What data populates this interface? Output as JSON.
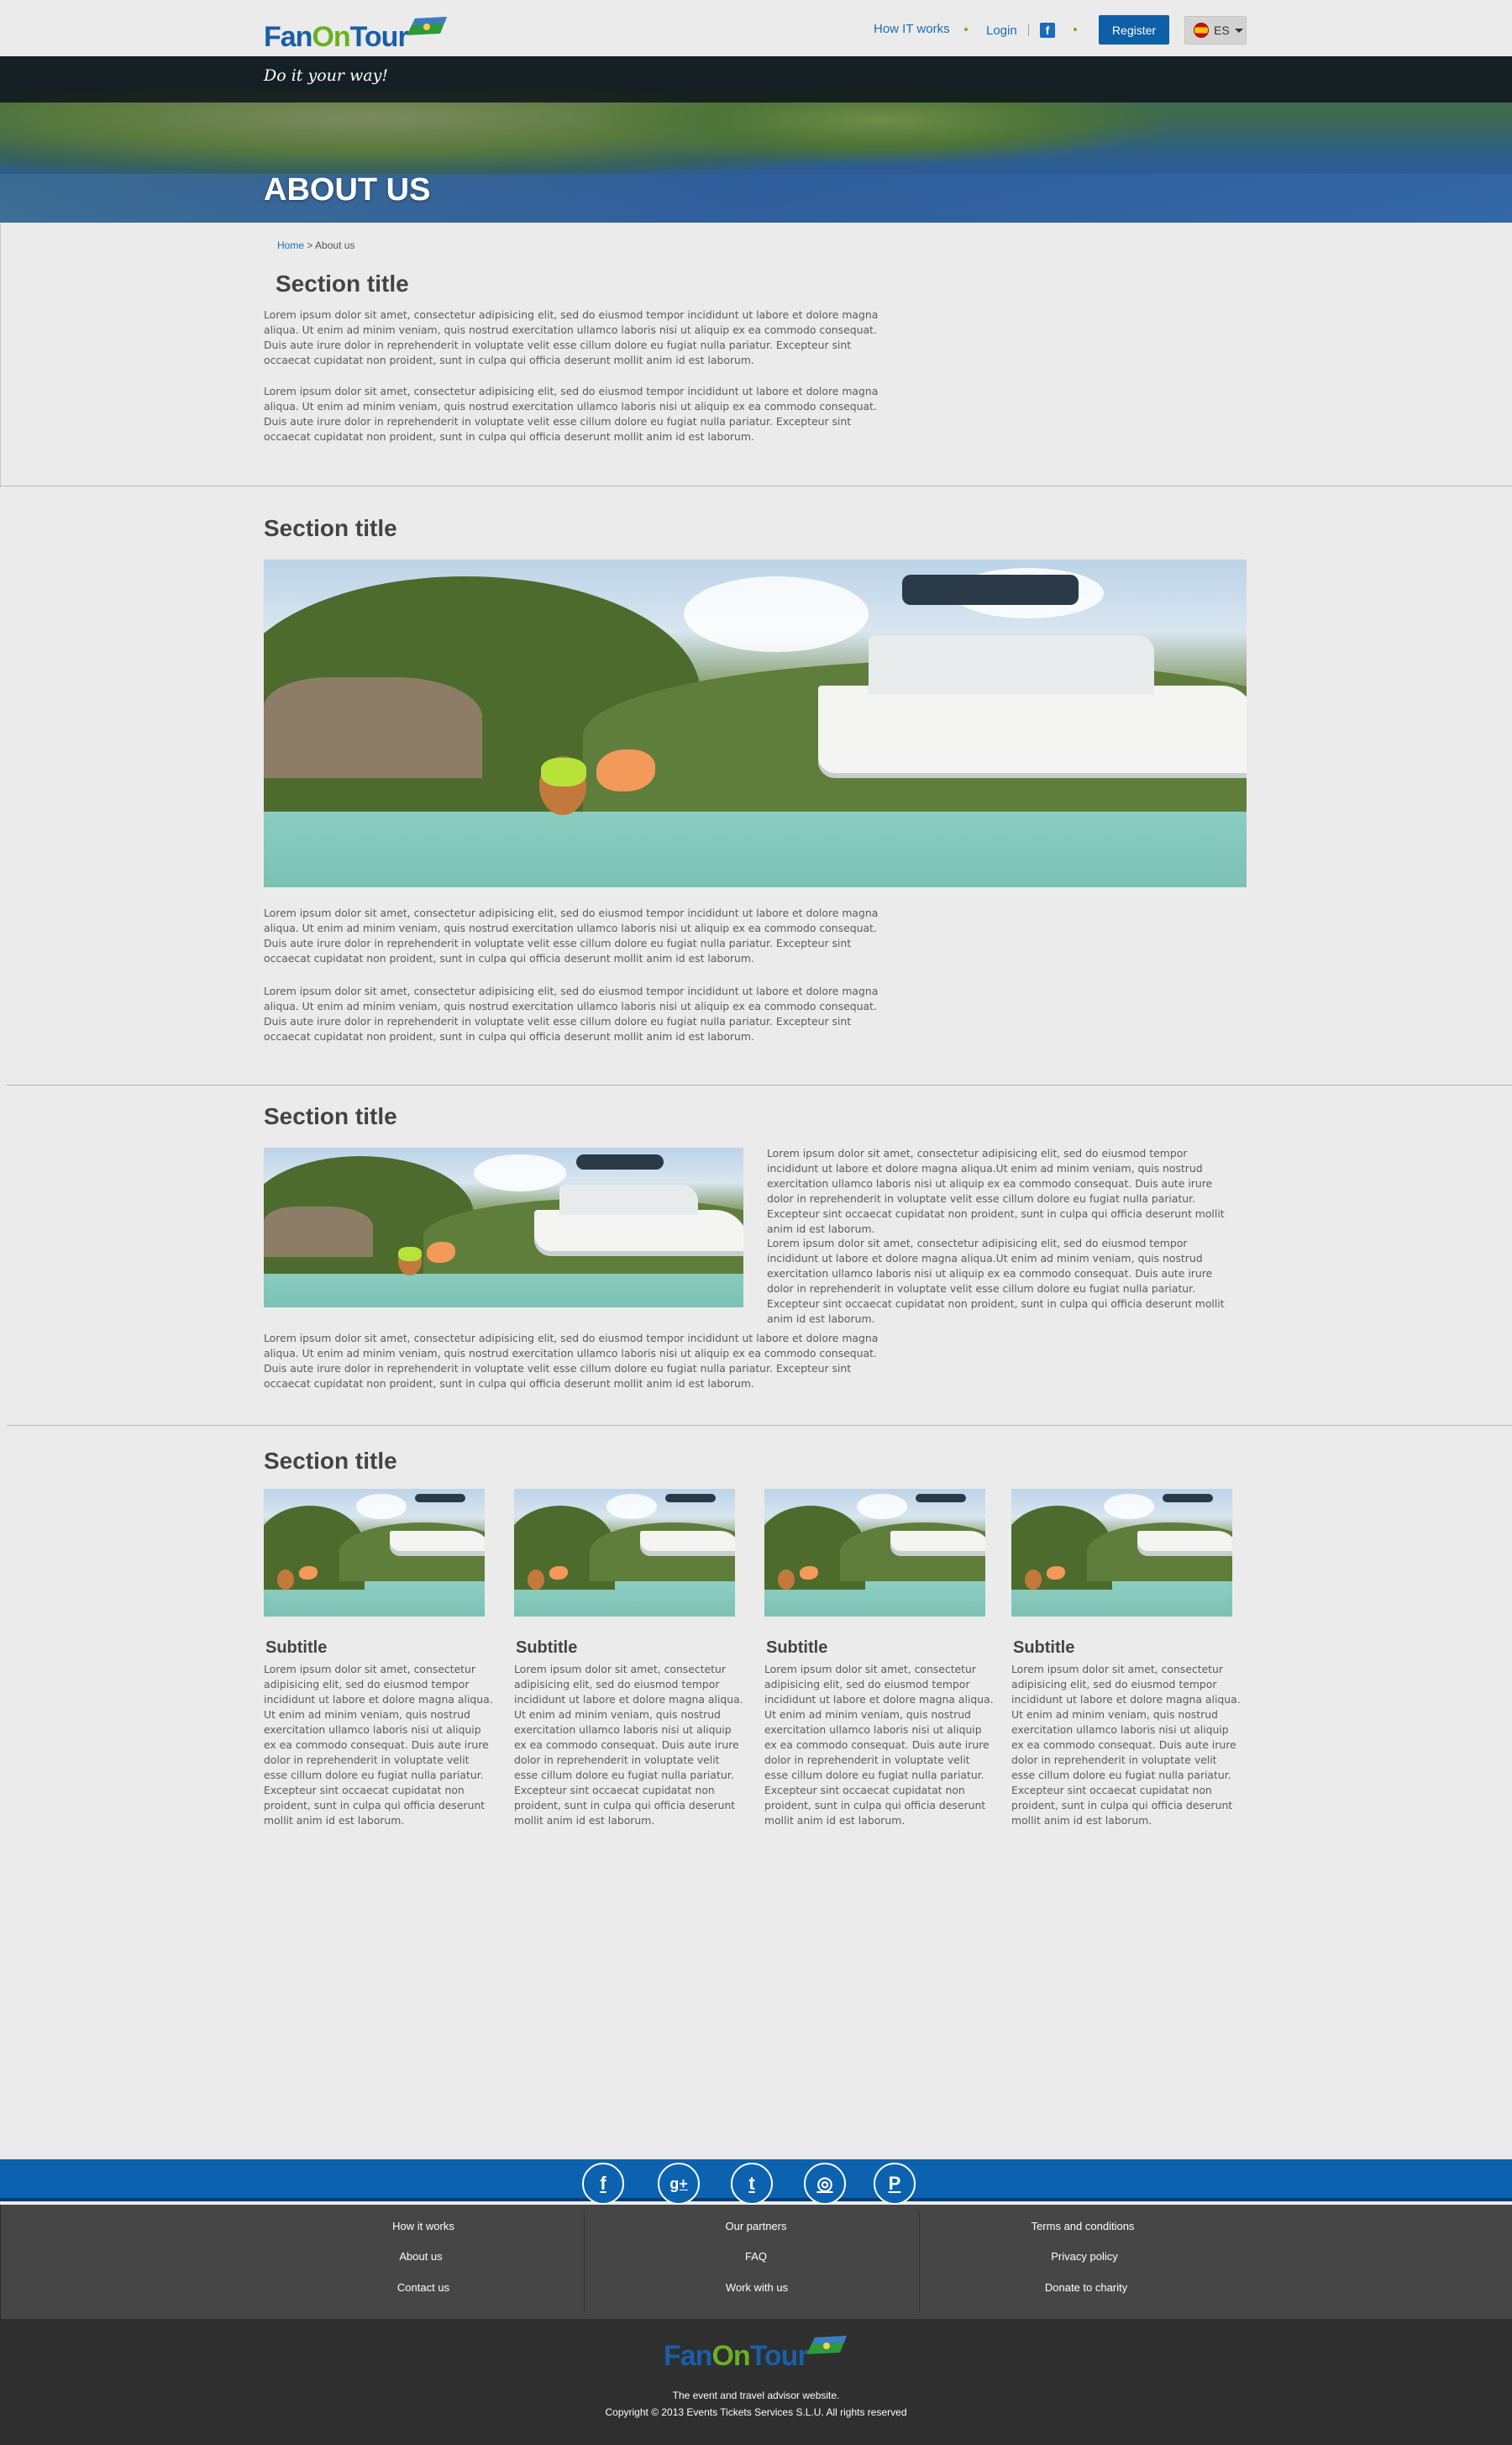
{
  "brand": {
    "fan": "Fan",
    "on": "On",
    "tour": "Tour",
    "tagline": "Do it your way!"
  },
  "header": {
    "nav": {
      "how_it_works": "How IT works",
      "login": "Login",
      "facebook": "f"
    },
    "register": "Register",
    "language": "ES"
  },
  "hero": {
    "title": "ABOUT US"
  },
  "breadcrumb": {
    "home": "Home",
    "separator": ">",
    "current": "About us"
  },
  "sections": [
    {
      "title": "Section title",
      "paragraphs": [
        "Lorem ipsum dolor sit amet, consectetur adipisicing elit, sed do eiusmod tempor incididunt ut labore et dolore magna aliqua. Ut enim ad minim veniam, quis nostrud exercitation ullamco laboris nisi ut aliquip ex ea commodo consequat. Duis aute irure dolor in reprehenderit in voluptate velit esse cillum dolore eu fugiat nulla pariatur. Excepteur sint occaecat cupidatat non proident, sunt in culpa qui officia deserunt mollit anim id est laborum.",
        "Lorem ipsum dolor sit amet, consectetur adipisicing elit, sed do eiusmod tempor incididunt ut labore et dolore magna aliqua. Ut enim ad minim veniam, quis nostrud exercitation ullamco laboris nisi ut aliquip ex ea commodo consequat. Duis aute irure dolor in reprehenderit in voluptate velit esse cillum dolore eu fugiat nulla pariatur. Excepteur sint occaecat cupidatat non proident, sunt in culpa qui officia deserunt mollit anim id est laborum."
      ]
    },
    {
      "title": "Section title",
      "paragraphs": [
        "Lorem ipsum dolor sit amet, consectetur adipisicing elit, sed do eiusmod tempor incididunt ut labore et dolore magna aliqua. Ut enim ad minim veniam, quis nostrud exercitation ullamco laboris nisi ut aliquip ex ea commodo consequat. Duis aute irure dolor in reprehenderit in voluptate velit esse cillum dolore eu fugiat nulla pariatur. Excepteur sint occaecat cupidatat non proident, sunt in culpa qui officia deserunt mollit anim id est laborum.",
        "Lorem ipsum dolor sit amet, consectetur adipisicing elit, sed do eiusmod tempor incididunt ut labore et dolore magna aliqua. Ut enim ad minim veniam, quis nostrud exercitation ullamco laboris nisi ut aliquip ex ea commodo consequat. Duis aute irure dolor in reprehenderit in voluptate velit esse cillum dolore eu fugiat nulla pariatur. Excepteur sint occaecat cupidatat non proident, sunt in culpa qui officia deserunt mollit anim id est laborum."
      ]
    },
    {
      "title": "Section title",
      "side_paragraphs": [
        "Lorem ipsum dolor sit amet, consectetur adipisicing elit, sed do eiusmod tempor incididunt ut labore et dolore magna aliqua.Ut enim ad minim veniam, quis nostrud exercitation ullamco laboris nisi ut aliquip ex ea commodo consequat. Duis aute irure dolor in reprehenderit in voluptate velit esse cillum dolore eu fugiat nulla pariatur. Excepteur sint occaecat cupidatat non proident, sunt in culpa qui officia deserunt mollit anim id est laborum.",
        "Lorem ipsum dolor sit amet, consectetur adipisicing elit, sed do eiusmod tempor incididunt ut labore et dolore magna aliqua.Ut enim ad minim veniam, quis nostrud exercitation ullamco laboris nisi ut aliquip ex ea commodo consequat. Duis aute irure dolor in reprehenderit in voluptate velit esse cillum dolore eu fugiat nulla pariatur. Excepteur sint occaecat cupidatat non proident, sunt in culpa qui officia deserunt mollit anim id est laborum."
      ],
      "paragraph": "Lorem ipsum dolor sit amet, consectetur adipisicing elit, sed do eiusmod tempor incididunt ut labore et dolore magna aliqua. Ut enim ad minim veniam, quis nostrud exercitation ullamco laboris nisi ut aliquip ex ea commodo consequat. Duis aute irure dolor in reprehenderit in voluptate velit esse cillum dolore eu fugiat nulla pariatur. Excepteur sint occaecat cupidatat non proident, sunt in culpa qui officia deserunt mollit anim id est laborum."
    },
    {
      "title": "Section title",
      "cards": [
        {
          "subtitle": "Subtitle",
          "text": "Lorem ipsum dolor sit amet, consectetur adipisicing elit, sed do eiusmod tempor incididunt ut labore et dolore magna aliqua. Ut enim ad minim veniam, quis nostrud exercitation ullamco laboris nisi ut aliquip ex ea commodo consequat. Duis aute irure dolor in reprehenderit in voluptate velit esse cillum dolore eu fugiat nulla pariatur. Excepteur sint occaecat cupidatat non proident, sunt in culpa qui officia deserunt mollit anim id est laborum."
        },
        {
          "subtitle": "Subtitle",
          "text": "Lorem ipsum dolor sit amet, consectetur adipisicing elit, sed do eiusmod tempor incididunt ut labore et dolore magna aliqua. Ut enim ad minim veniam, quis nostrud exercitation ullamco laboris nisi ut aliquip ex ea commodo consequat. Duis aute irure dolor in reprehenderit in voluptate velit esse cillum dolore eu fugiat nulla pariatur. Excepteur sint occaecat cupidatat non proident, sunt in culpa qui officia deserunt mollit anim id est laborum."
        },
        {
          "subtitle": "Subtitle",
          "text": "Lorem ipsum dolor sit amet, consectetur adipisicing elit, sed do eiusmod tempor incididunt ut labore et dolore magna aliqua. Ut enim ad minim veniam, quis nostrud exercitation ullamco laboris nisi ut aliquip ex ea commodo consequat. Duis aute irure dolor in reprehenderit in voluptate velit esse cillum dolore eu fugiat nulla pariatur. Excepteur sint occaecat cupidatat non proident, sunt in culpa qui officia deserunt mollit anim id est laborum."
        },
        {
          "subtitle": "Subtitle",
          "text": "Lorem ipsum dolor sit amet, consectetur adipisicing elit, sed do eiusmod tempor incididunt ut labore et dolore magna aliqua. Ut enim ad minim veniam, quis nostrud exercitation ullamco laboris nisi ut aliquip ex ea commodo consequat. Duis aute irure dolor in reprehenderit in voluptate velit esse cillum dolore eu fugiat nulla pariatur. Excepteur sint occaecat cupidatat non proident, sunt in culpa qui officia deserunt mollit anim id est laborum."
        }
      ]
    }
  ],
  "social": [
    {
      "name": "facebook-icon",
      "glyph": "f"
    },
    {
      "name": "google-plus-icon",
      "glyph": "g+"
    },
    {
      "name": "twitter-icon",
      "glyph": "t"
    },
    {
      "name": "instagram-icon",
      "glyph": "◎"
    },
    {
      "name": "pinterest-icon",
      "glyph": "P"
    }
  ],
  "footer": {
    "col1": [
      "How it works",
      "About us",
      "Contact us"
    ],
    "col2": [
      "Our partners",
      "FAQ",
      "Work with us"
    ],
    "col3": [
      "Terms and conditions",
      "Privacy policy",
      "Donate to charity"
    ],
    "description": "The event and travel advisor website.",
    "copyright": "Copyright © 2013 Events Tickets Services S.L.U. All rights reserved"
  },
  "colors": {
    "brand_blue": "#1a5ea8",
    "brand_green": "#6ab023",
    "social_bar": "#0d62b0"
  }
}
